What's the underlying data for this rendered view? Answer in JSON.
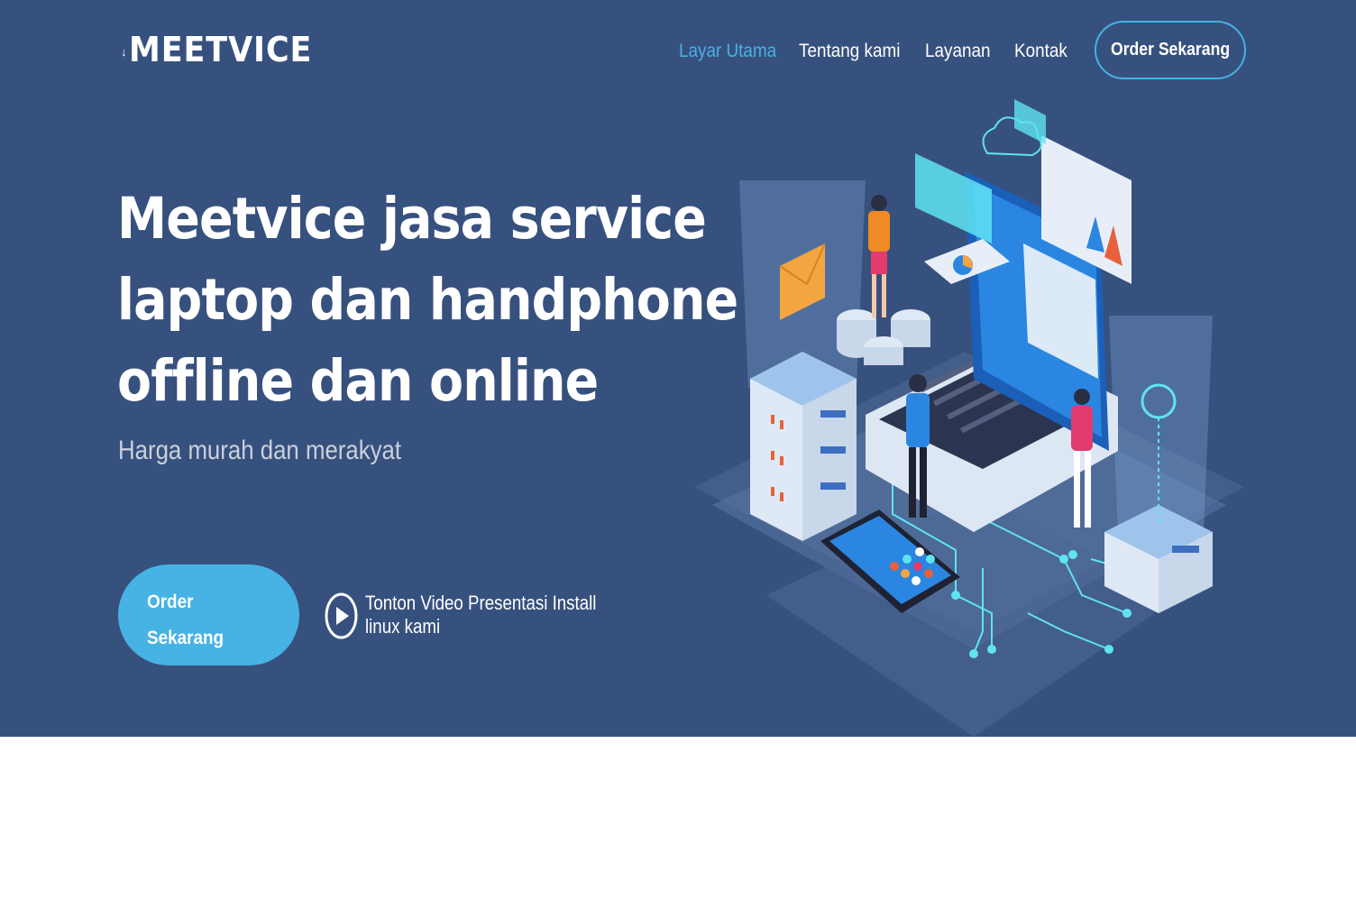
{
  "header": {
    "logo": "MEETVICE",
    "nav": [
      {
        "label": "Layar Utama",
        "active": true
      },
      {
        "label": "Tentang kami",
        "active": false
      },
      {
        "label": "Layanan",
        "active": false
      },
      {
        "label": "Kontak",
        "active": false
      }
    ],
    "cta_label": "Order Sekarang"
  },
  "hero": {
    "headline_lines": [
      "Meetvice jasa service",
      "laptop dan handphone",
      "offline dan online"
    ],
    "subtitle": "Harga murah dan merakyat",
    "order_button": "Order Sekarang",
    "video_link": "Tonton Video Presentasi Install linux kami"
  },
  "colors": {
    "hero_background": "#37517e",
    "accent": "#47b2e4",
    "text": "#ffffff",
    "subtitle": "#c9d1dc"
  },
  "icons": {
    "play": "play-circle-icon",
    "logo_mark": "arrow-down-icon"
  }
}
